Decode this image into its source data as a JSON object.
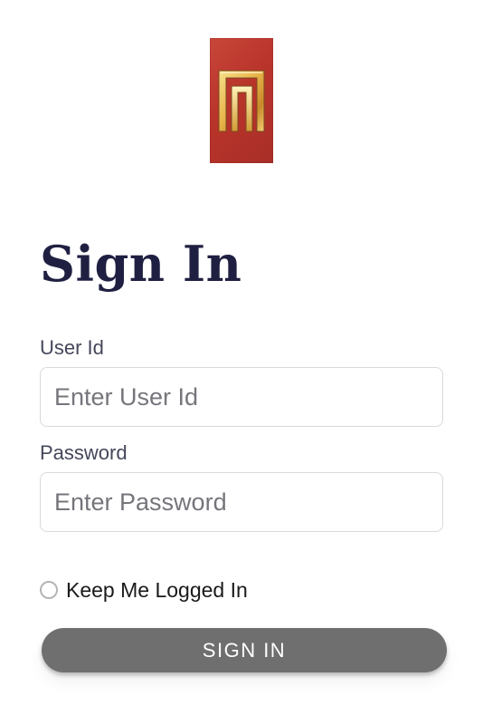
{
  "title": "Sign In",
  "user_id": {
    "label": "User Id",
    "placeholder": "Enter User Id",
    "value": ""
  },
  "password": {
    "label": "Password",
    "placeholder": "Enter Password",
    "value": ""
  },
  "keep_logged_in": {
    "label": "Keep Me Logged In",
    "checked": false
  },
  "sign_in_button": {
    "label": "SIGN IN"
  },
  "colors": {
    "title": "#1f2041",
    "logo_background": "#b9342b",
    "logo_mark": "#e8b54a",
    "button_background": "#6f6f6f",
    "button_text": "#ffffff",
    "input_border": "#d9d9de"
  },
  "icons": {
    "logo": "n-letter-logo",
    "keep_logged_in": "radio-unchecked-icon"
  }
}
